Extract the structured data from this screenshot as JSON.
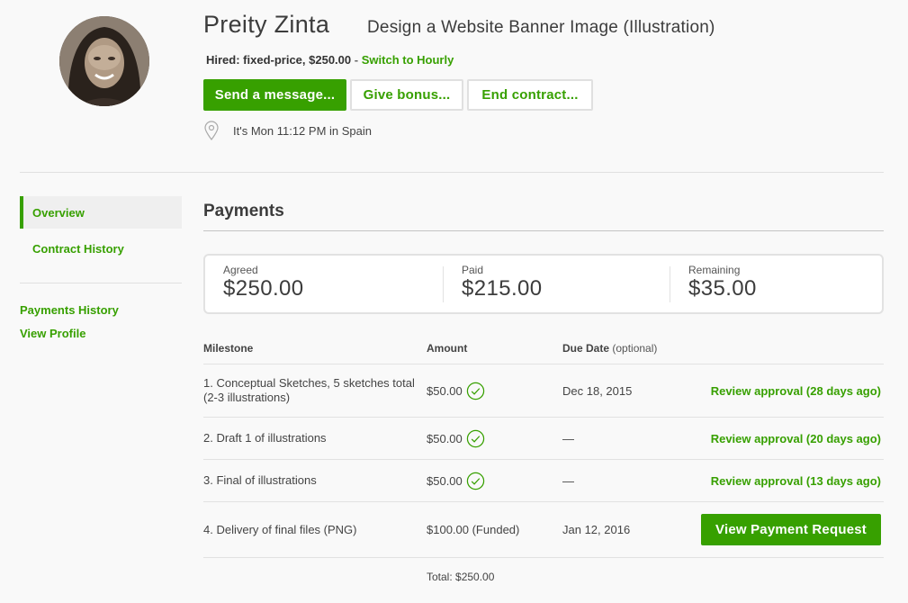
{
  "header": {
    "freelancer_name": "Preity Zinta",
    "job_title": "Design a Website Banner Image (Illustration)",
    "hired_text": "Hired: fixed-price, $250.00",
    "hired_separator": "-",
    "switch_link": "Switch to Hourly",
    "buttons": {
      "send_message": "Send a message...",
      "give_bonus": "Give bonus...",
      "end_contract": "End contract..."
    },
    "location_text": "It's Mon 11:12 PM in Spain",
    "icons": {
      "avatar": "profile-photo",
      "location": "map-pin-icon"
    }
  },
  "sidebar": {
    "nav": [
      {
        "label": "Overview",
        "active": true
      },
      {
        "label": "Contract History",
        "active": false
      }
    ],
    "links": [
      {
        "label": "Payments History"
      },
      {
        "label": "View Profile"
      }
    ]
  },
  "payments": {
    "title": "Payments",
    "summary": [
      {
        "label": "Agreed",
        "value": "$250.00"
      },
      {
        "label": "Paid",
        "value": "$215.00"
      },
      {
        "label": "Remaining",
        "value": "$35.00"
      }
    ],
    "columns": {
      "milestone": "Milestone",
      "amount": "Amount",
      "due_date": "Due Date",
      "due_date_note": "(optional)"
    },
    "milestones": [
      {
        "name": "1. Conceptual Sketches, 5 sketches total (2-3 illustrations)",
        "amount": "$50.00",
        "paid_icon": "check-circle-icon",
        "due": "Dec 18, 2015",
        "action": "Review approval (28 days ago)"
      },
      {
        "name": "2. Draft 1 of illustrations",
        "amount": "$50.00",
        "paid_icon": "check-circle-icon",
        "due": "—",
        "action": "Review approval (20 days ago)"
      },
      {
        "name": "3. Final of illustrations",
        "amount": "$50.00",
        "paid_icon": "check-circle-icon",
        "due": "—",
        "action": "Review approval (13 days ago)"
      },
      {
        "name": "4. Delivery of final files (PNG)",
        "amount": "$100.00 (Funded)",
        "due": "Jan 12, 2016",
        "action": "View Payment Request"
      }
    ],
    "total": "Total: $250.00"
  },
  "colors": {
    "brand_green": "#37a000",
    "background": "#f9f9f9",
    "text": "#333333",
    "border": "#e2e2e2"
  }
}
